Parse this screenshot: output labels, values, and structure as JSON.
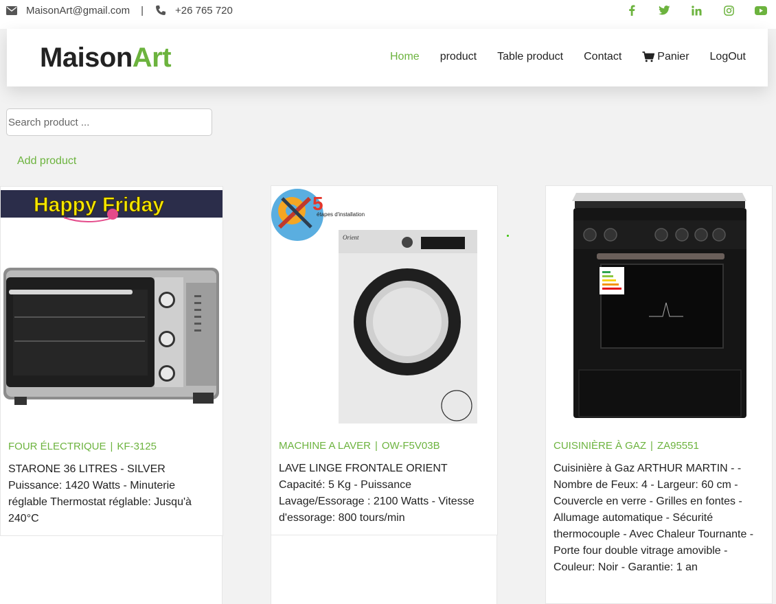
{
  "topbar": {
    "email": "MaisonArt@gmail.com",
    "separator": "|",
    "phone": "+26 765 720",
    "socials": [
      "facebook-icon",
      "twitter-icon",
      "linkedin-icon",
      "instagram-icon",
      "youtube-icon"
    ]
  },
  "brand": {
    "part1": "Maison",
    "part2": "Art"
  },
  "nav": {
    "home": "Home",
    "product": "product",
    "table_product": "Table product",
    "contact": "Contact",
    "panier": "Panier",
    "logout": "LogOut"
  },
  "search": {
    "placeholder": "Search product ..."
  },
  "add_product": "Add product",
  "products": [
    {
      "category": "FOUR ÉLECTRIQUE",
      "ref": "KF-3125",
      "title": "STARONE 36 LITRES - SILVER",
      "description": "Puissance: 1420 Watts - Minuterie réglable Thermostat réglable: Jusqu'à 240°C",
      "banner": "Happy Friday"
    },
    {
      "category": "MACHINE A LAVER",
      "ref": "OW-F5V03B",
      "title": "LAVE LINGE FRONTALE ORIENT",
      "description": "Capacité: 5 Kg - Puissance Lavage/Essorage : 2100 Watts - Vitesse d'essorage: 800 tours/min",
      "badge_number": "5",
      "badge_text": "étapes d'installation",
      "brand_label": "Orient"
    },
    {
      "category": "CUISINIÈRE À GAZ",
      "ref": "ZA95551",
      "title": "Cuisinière à Gaz ARTHUR MARTIN - - Nombre de Feux: 4 - Largeur: 60 cm - Couvercle en verre - Grilles en fontes - Allumage automatique - Sécurité thermocouple - Avec Chaleur Tournante - Porte four double vitrage amovible - Couleur: Noir - Garantie: 1 an",
      "description": ""
    }
  ],
  "colors": {
    "accent": "#6cb33e",
    "background": "#f2f2f2"
  }
}
